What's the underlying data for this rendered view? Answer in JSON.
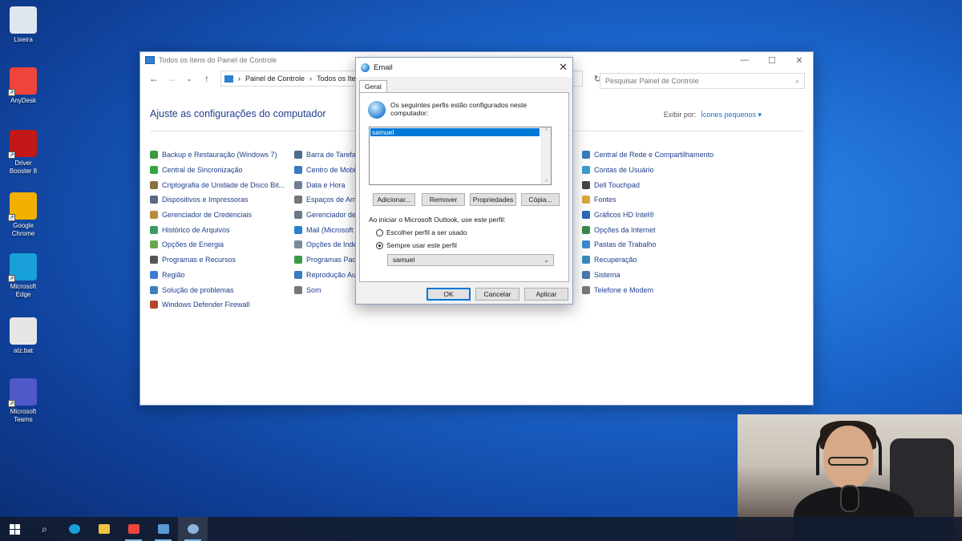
{
  "desktop": {
    "icons": [
      {
        "label": "Lixeira",
        "icon": "recycle-bin-icon",
        "color": "#dfe6ee"
      },
      {
        "label": "AnyDesk",
        "icon": "anydesk-icon",
        "color": "#ef443b"
      },
      {
        "label": "Driver Booster 8",
        "icon": "driver-booster-icon",
        "color": "#c21818"
      },
      {
        "label": "Google Chrome",
        "icon": "chrome-icon",
        "color": "#f2b100"
      },
      {
        "label": "Microsoft Edge",
        "icon": "edge-icon",
        "color": "#1aa0d8"
      },
      {
        "label": "atz.bat",
        "icon": "batch-file-icon",
        "color": "#e6e6e6"
      },
      {
        "label": "Microsoft Teams",
        "icon": "teams-icon",
        "color": "#5059c9"
      }
    ]
  },
  "control_panel": {
    "title": "Todos os Itens do Painel de Controle",
    "breadcrumb": [
      "Painel de Controle",
      "Todos os Itens do"
    ],
    "search_placeholder": "Pesquisar Painel de Controle",
    "heading": "Ajuste as configurações do computador",
    "view_by_label": "Exibir por:",
    "view_by_value": "Ícones pequenos ▾",
    "columns": [
      [
        {
          "label": "Backup e Restauração (Windows 7)",
          "color": "#3c9a3c"
        },
        {
          "label": "Central de Sincronização",
          "color": "#35a645"
        },
        {
          "label": "Criptografia de Unidade de Disco Bit...",
          "color": "#8a7040"
        },
        {
          "label": "Dispositivos e Impressoras",
          "color": "#5a6a80"
        },
        {
          "label": "Gerenciador de Credenciais",
          "color": "#b88a3a"
        },
        {
          "label": "Histórico de Arquivos",
          "color": "#3a9a60"
        },
        {
          "label": "Opções de Energia",
          "color": "#6aa84f"
        },
        {
          "label": "Programas e Recursos",
          "color": "#555555"
        },
        {
          "label": "Região",
          "color": "#3b7ed1"
        },
        {
          "label": "Solução de problemas",
          "color": "#3f7fbf"
        },
        {
          "label": "Windows Defender Firewall",
          "color": "#b5452f"
        }
      ],
      [
        {
          "label": "Barra de Tarefas",
          "color": "#4b6b8f"
        },
        {
          "label": "Centro de Mobi",
          "color": "#3a78c2"
        },
        {
          "label": "Data e Hora",
          "color": "#6e7f96"
        },
        {
          "label": "Espaços de Arm",
          "color": "#777777"
        },
        {
          "label": "Gerenciador de",
          "color": "#6a7a8a"
        },
        {
          "label": "Mail (Microsoft",
          "color": "#2b7fd0"
        },
        {
          "label": "Opções de Inde",
          "color": "#7a8a9a"
        },
        {
          "label": "Programas Padr",
          "color": "#3a9a4a"
        },
        {
          "label": "Reprodução Au",
          "color": "#3a7ac0"
        },
        {
          "label": "Som",
          "color": "#777777"
        }
      ],
      [
        {
          "label": "Central de Rede e Compartilhamento",
          "color": "#3a7ac0"
        },
        {
          "label": "Contas de Usuário",
          "color": "#3a9ad0"
        },
        {
          "label": "Dell Touchpad",
          "color": "#444444"
        },
        {
          "label": "Fontes",
          "color": "#d8a83a"
        },
        {
          "label": "Gráficos HD Intel®",
          "color": "#2a6ab8"
        },
        {
          "label": "Opções da Internet",
          "color": "#3a8a4a"
        },
        {
          "label": "Pastas de Trabalho",
          "color": "#3a8acf"
        },
        {
          "label": "Recuperação",
          "color": "#3a8abf"
        },
        {
          "label": "Sistema",
          "color": "#4a7ab0"
        },
        {
          "label": "Telefone e Modem",
          "color": "#777777"
        }
      ]
    ]
  },
  "email_dialog": {
    "title": "Email",
    "tab": "Geral",
    "info_text": "Os seguintes perfis estão configurados neste computador:",
    "profiles": [
      "samuel"
    ],
    "buttons": {
      "add": "Adicionar...",
      "remove": "Remover",
      "properties": "Propriedades",
      "copy": "Cópia..."
    },
    "startup_label": "Ao iniciar o Microsoft Outlook, use este perfil:",
    "radio_choose": "Escolher perfil a ser usado",
    "radio_always": "Sempre usar este perfil",
    "selected_option": "always",
    "profile_select": "samuel",
    "ok": "OK",
    "cancel": "Cancelar",
    "apply": "Aplicar"
  },
  "taskbar": {
    "items": [
      "windows-start-icon",
      "search-icon",
      "edge-icon",
      "file-explorer-icon",
      "anydesk-icon",
      "control-panel-icon",
      "mail-icon"
    ]
  }
}
